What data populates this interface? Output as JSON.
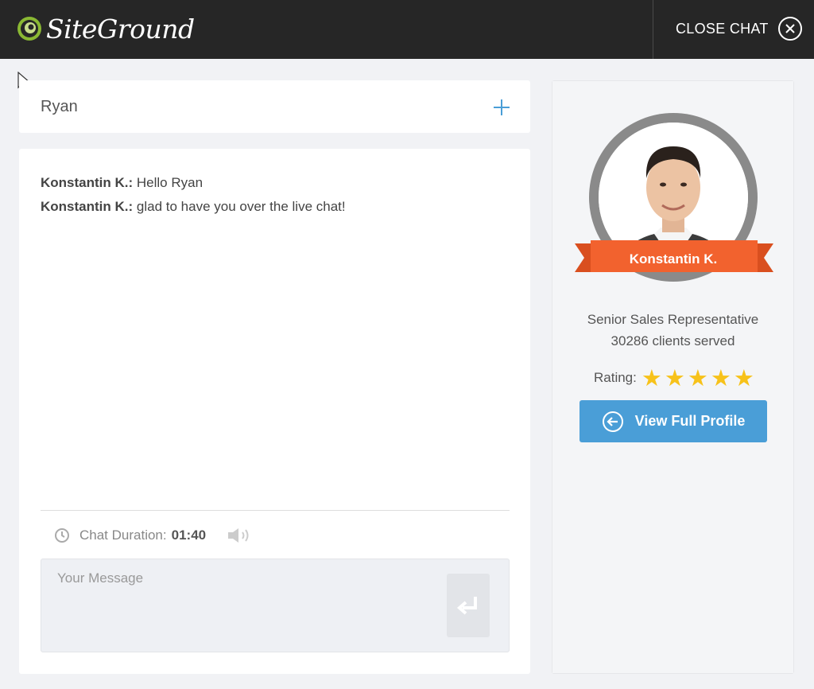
{
  "header": {
    "brand": "SiteGround",
    "close_label": "CLOSE CHAT"
  },
  "customer": {
    "name": "Ryan"
  },
  "chat": {
    "messages": [
      {
        "author": "Konstantin K.:",
        "text": "Hello Ryan"
      },
      {
        "author": "Konstantin K.:",
        "text": "glad to have you over the live chat!"
      }
    ],
    "duration_label": "Chat Duration:",
    "duration_value": "01:40",
    "input_placeholder": "Your Message"
  },
  "agent": {
    "name": "Konstantin K.",
    "title": "Senior Sales Representative",
    "clients": "30286 clients served",
    "rating_label": "Rating:",
    "rating_stars": 5,
    "profile_button": "View Full Profile"
  },
  "colors": {
    "topbar": "#262626",
    "accent_blue": "#4a9ed7",
    "ribbon_orange": "#f2622e",
    "star_yellow": "#f7c21a"
  },
  "icons": {
    "logo": "siteground-logo-icon",
    "close": "close-circle-icon",
    "plus": "plus-icon",
    "clock": "clock-icon",
    "sound": "speaker-icon",
    "send": "enter-arrow-icon",
    "profile": "arrow-left-circle-icon"
  }
}
